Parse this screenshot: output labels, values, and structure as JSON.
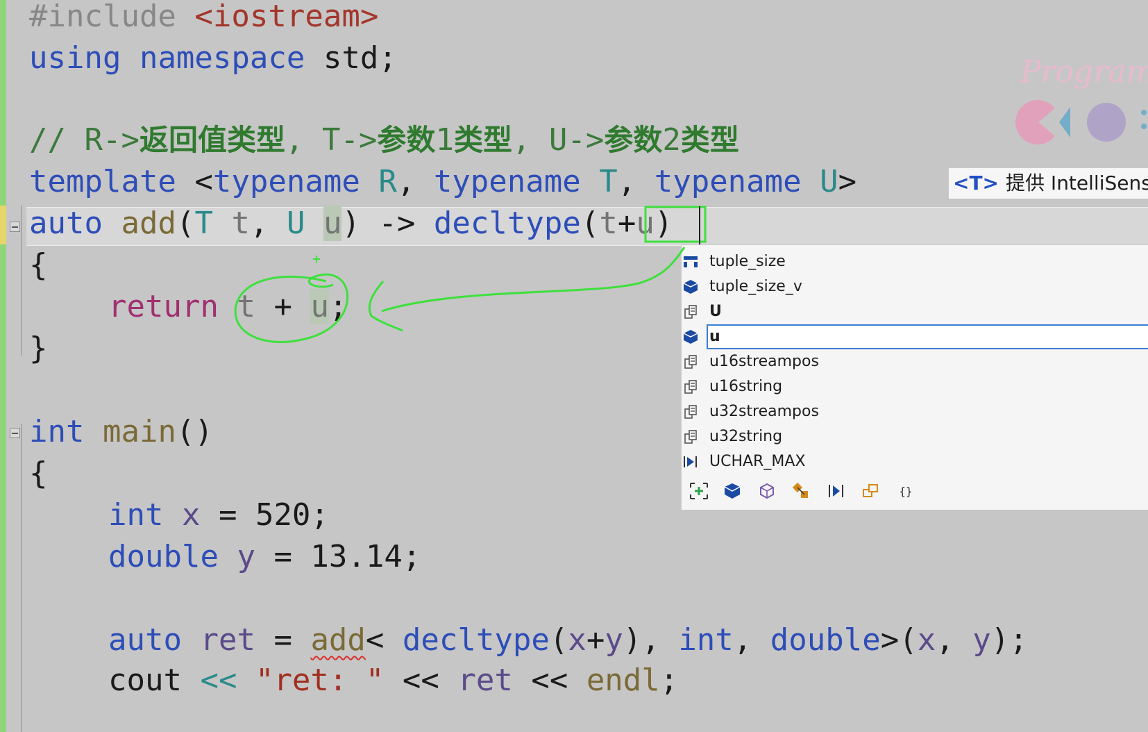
{
  "editor": {
    "lines": {
      "l1": {
        "a": "#include ",
        "b": "<iostream>"
      },
      "l2": {
        "a": "using",
        "b": " ",
        "c": "namespace",
        "d": " std;"
      },
      "l3": {
        "a": "// R->",
        "b": "返回值类型",
        "c": ", T->",
        "d": "参数",
        "e": "1",
        "f": "类型",
        "g": ", U->",
        "h": "参数",
        "i": "2",
        "j": "类型"
      },
      "l4": {
        "a": "template",
        "b": " <",
        "c": "typename",
        "d": " ",
        "e": "R",
        "f": ", ",
        "g": "typename",
        "h": " ",
        "i": "T",
        "j": ", ",
        "k": "typename",
        "l": " ",
        "m": "U",
        "n": ">"
      },
      "l5": {
        "a": "auto",
        "b": " ",
        "c": "add",
        "d": "(",
        "e": "T",
        "f": " ",
        "g": "t",
        "h": ", ",
        "i": "U",
        "j": " ",
        "k": "u",
        "l": ") -> ",
        "m": "decltype",
        "n": "(",
        "o": "t",
        "p": "+",
        "q": "u",
        "r": ")"
      },
      "l6": {
        "a": "{"
      },
      "l7": {
        "a": "return",
        "b": " ",
        "c": "t",
        "d": " + ",
        "e": "u",
        "f": ";"
      },
      "l8": {
        "a": "}"
      },
      "l9": {
        "a": "int",
        "b": " ",
        "c": "main",
        "d": "()"
      },
      "l10": {
        "a": "{"
      },
      "l11": {
        "a": "int",
        "b": " ",
        "c": "x",
        "d": " = 520;"
      },
      "l12": {
        "a": "double",
        "b": " ",
        "c": "y",
        "d": " = 13.14;"
      },
      "l13": {
        "a": "auto",
        "b": " ",
        "c": "ret",
        "d": " = ",
        "e": "add",
        "f": "< ",
        "g": "decltype",
        "h": "(",
        "i": "x",
        "j": "+",
        "k": "y",
        "l": "), ",
        "m": "int",
        "n": ", ",
        "o": "double",
        "p": ">(",
        "q": "x",
        "r": ", ",
        "s": "y",
        "t": ");"
      },
      "l14": {
        "a": "cout",
        "b": " ",
        "c": "<<",
        "d": " ",
        "e": "\"ret: \"",
        "f": " << ",
        "g": "ret",
        "h": " << ",
        "i": "endl",
        "j": ";"
      }
    }
  },
  "tooltip": {
    "tag": "<T>",
    "text": "提供 IntelliSens"
  },
  "autocomplete": {
    "items": [
      {
        "label": "tuple_size",
        "icon": "type-alias-icon"
      },
      {
        "label": "tuple_size_v",
        "icon": "variable-icon"
      },
      {
        "label": "U",
        "icon": "template-param-icon"
      },
      {
        "label": "u",
        "icon": "variable-icon"
      },
      {
        "label": "u16streampos",
        "icon": "typedef-icon"
      },
      {
        "label": "u16string",
        "icon": "typedef-icon"
      },
      {
        "label": "u32streampos",
        "icon": "typedef-icon"
      },
      {
        "label": "u32string",
        "icon": "typedef-icon"
      },
      {
        "label": "UCHAR_MAX",
        "icon": "macro-icon"
      }
    ],
    "selected_index": 3,
    "filters": [
      "expand-filter-icon",
      "variable-filter-icon",
      "class-filter-icon",
      "member-filter-icon",
      "macro-filter-icon",
      "typedef-filter-icon",
      "namespace-filter-icon"
    ]
  },
  "colors": {
    "accent": "#3c7ed6",
    "annotation": "#3ee03e",
    "watermark": "#efb8cf"
  },
  "watermark": {
    "text": "Programm"
  }
}
